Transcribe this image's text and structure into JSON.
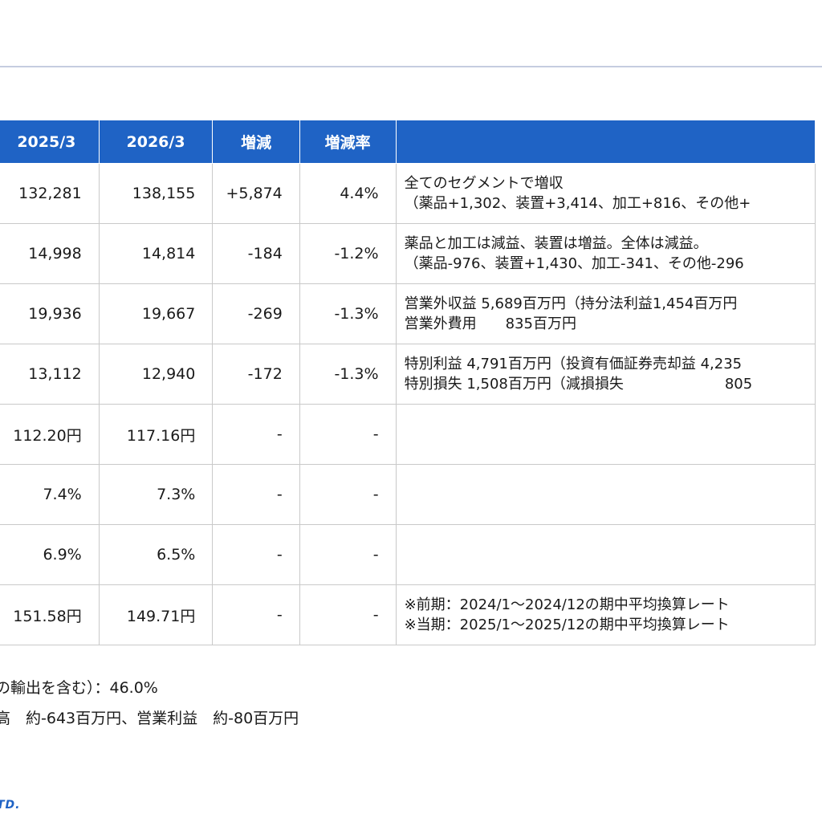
{
  "table": {
    "headers": [
      "2025/3",
      "2026/3",
      "増減",
      "増減率",
      ""
    ],
    "rows": [
      {
        "prev": "132,281",
        "curr": "138,155",
        "diff": "+5,874",
        "rate": "4.4%",
        "note": [
          "全てのセグメントで増収",
          "（薬品+1,302、装置+3,414、加工+816、その他+"
        ]
      },
      {
        "prev": "14,998",
        "curr": "14,814",
        "diff": "-184",
        "rate": "-1.2%",
        "note": [
          "薬品と加工は減益、装置は増益。全体は減益。",
          "（薬品-976、装置+1,430、加工-341、その他-296"
        ]
      },
      {
        "prev": "19,936",
        "curr": "19,667",
        "diff": "-269",
        "rate": "-1.3%",
        "note": [
          "営業外収益 5,689百万円（持分法利益1,454百万円",
          "営業外費用　　835百万円"
        ]
      },
      {
        "prev": "13,112",
        "curr": "12,940",
        "diff": "-172",
        "rate": "-1.3%",
        "note": [
          "特別利益 4,791百万円（投資有価証券売却益 4,235",
          "特別損失 1,508百万円（減損損失　　　　　　　805"
        ]
      },
      {
        "prev": "112.20円",
        "curr": "117.16円",
        "diff": "-",
        "rate": "-",
        "note": []
      },
      {
        "prev": "7.4%",
        "curr": "7.3%",
        "diff": "-",
        "rate": "-",
        "note": []
      },
      {
        "prev": "6.9%",
        "curr": "6.5%",
        "diff": "-",
        "rate": "-",
        "note": []
      },
      {
        "prev": "151.58円",
        "curr": "149.71円",
        "diff": "-",
        "rate": "-",
        "note": [
          "※前期：2024/1～2024/12の期中平均換算レート",
          "※当期：2025/1～2025/12の期中平均換算レート"
        ]
      }
    ]
  },
  "footer": {
    "line1": "の輸出を含む）：46.0%",
    "line2": "高　約-643百万円、営業利益　約-80百万円"
  },
  "logo": "TD."
}
